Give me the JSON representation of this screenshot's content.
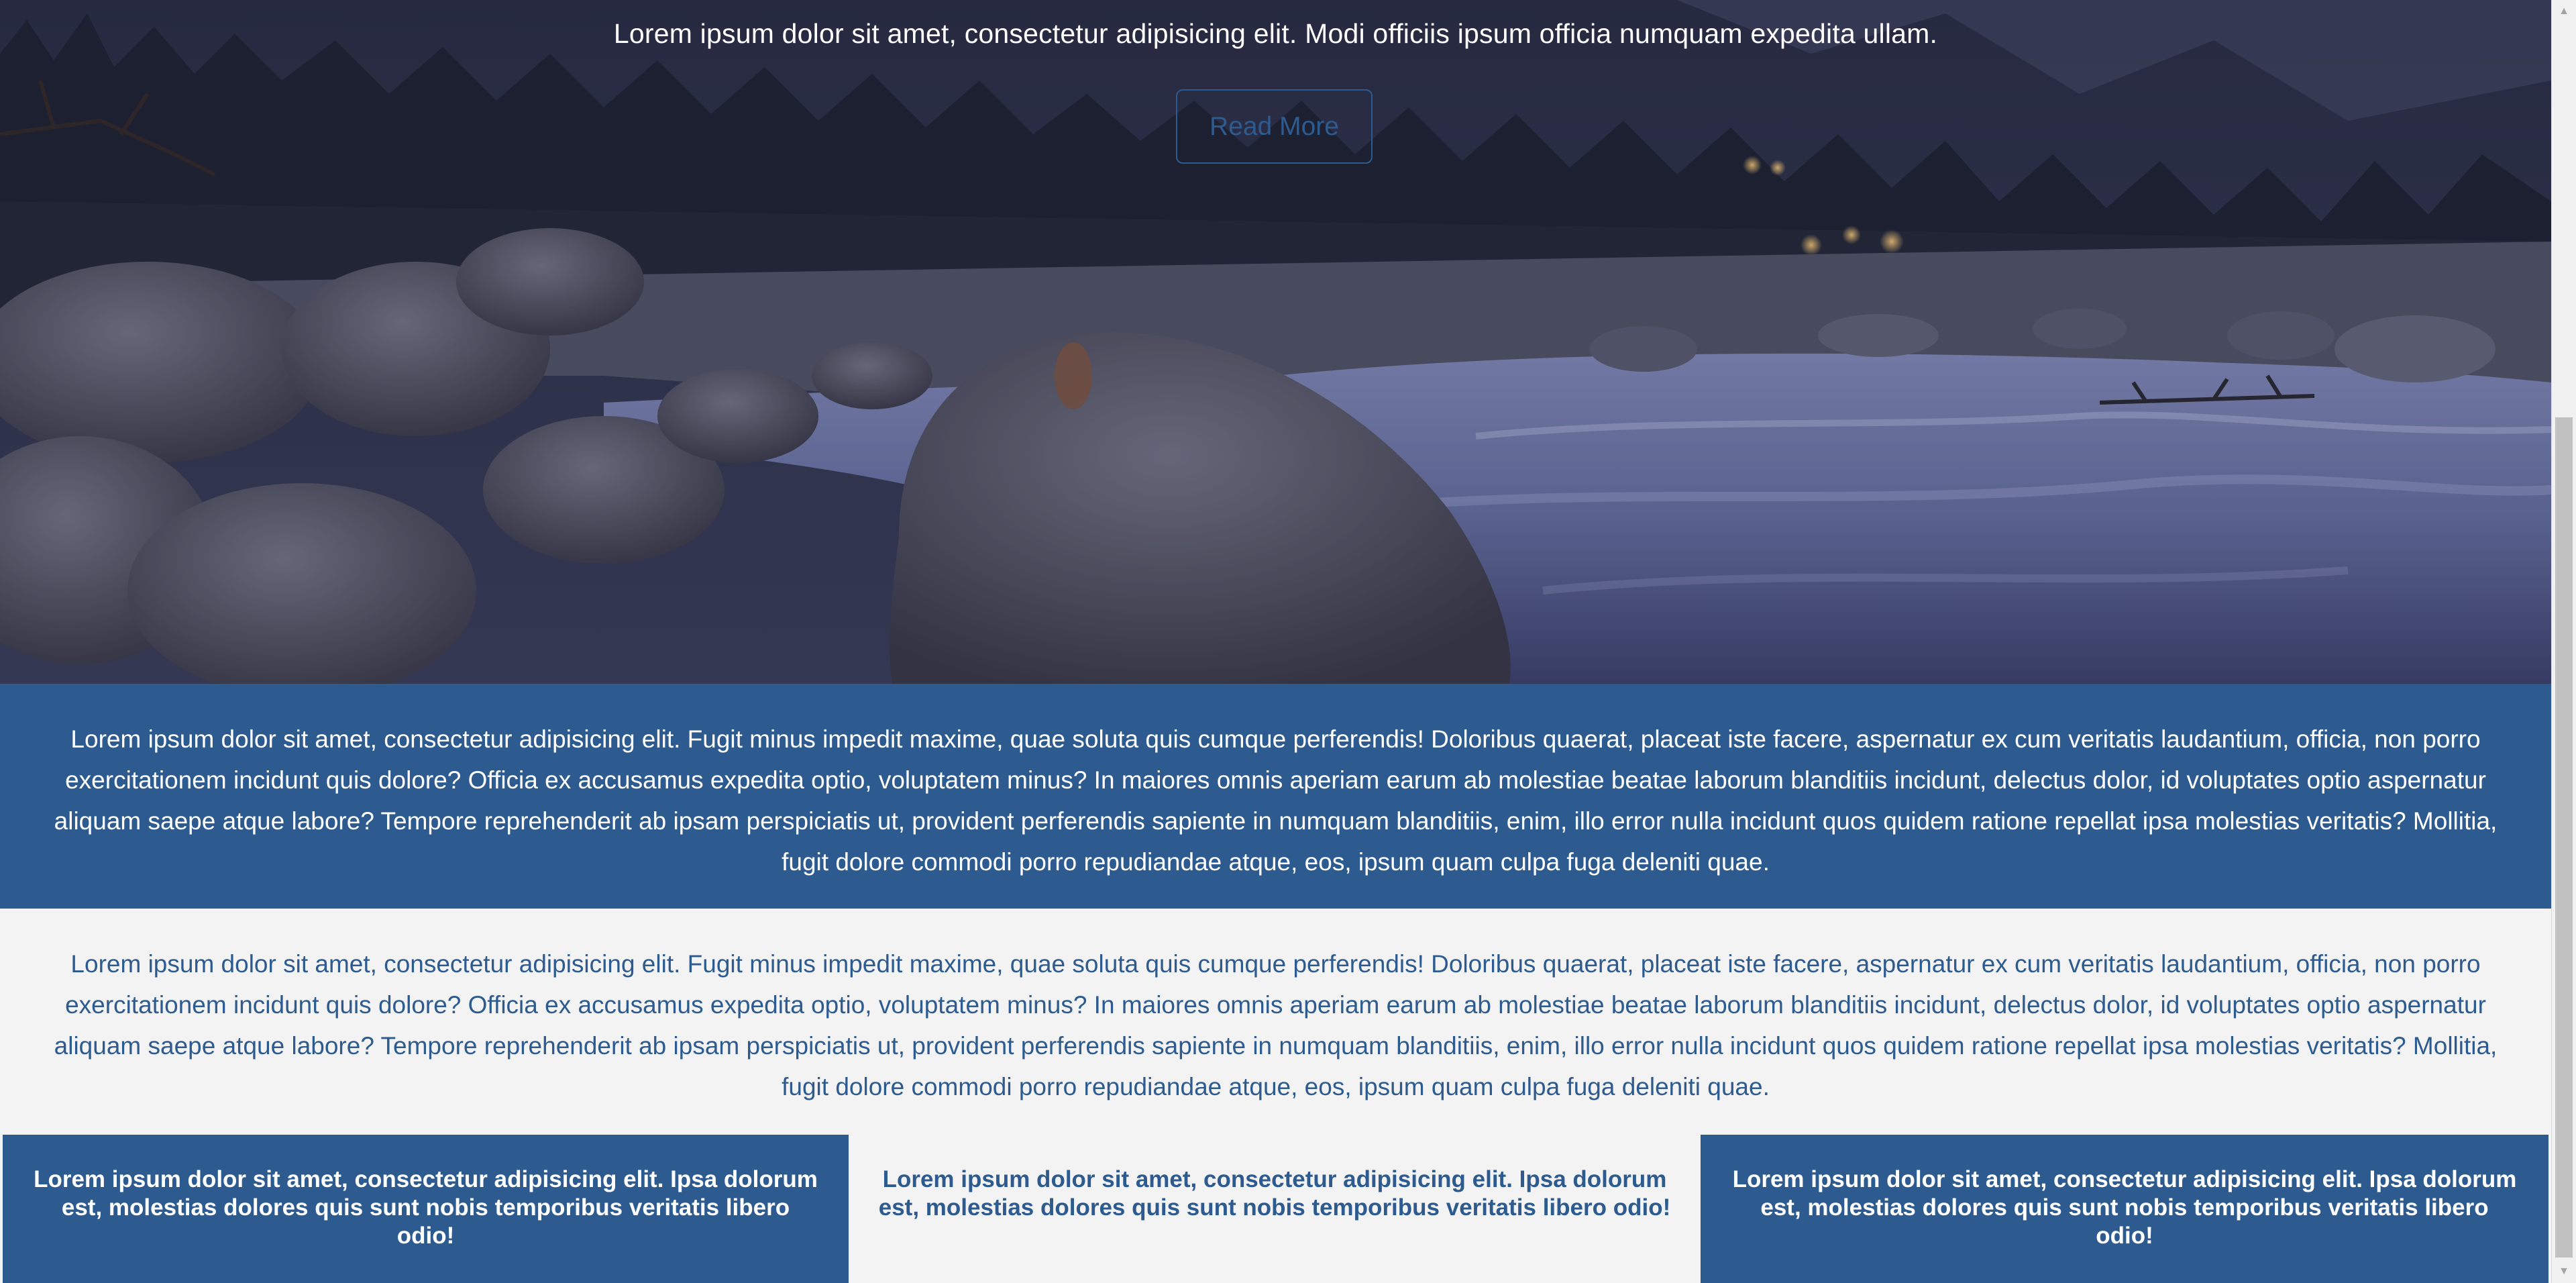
{
  "hero": {
    "tagline": "Lorem ipsum dolor sit amet, consectetur adipisicing elit. Modi officiis ipsum officia numquam expedita ullam.",
    "button_label": "Read More",
    "image_description_icon": "river-landscape-photo"
  },
  "band_blue": {
    "text": "Lorem ipsum dolor sit amet, consectetur adipisicing elit. Fugit minus impedit maxime, quae soluta quis cumque perferendis! Doloribus quaerat, placeat iste facere, aspernatur ex cum veritatis laudantium, officia, non porro exercitationem incidunt quis dolore? Officia ex accusamus expedita optio, voluptatem minus? In maiores omnis aperiam earum ab molestiae beatae laborum blanditiis incidunt, delectus dolor, id voluptates optio aspernatur aliquam saepe atque labore? Tempore reprehenderit ab ipsam perspiciatis ut, provident perferendis sapiente in numquam blanditiis, enim, illo error nulla incidunt quos quidem ratione repellat ipsa molestias veritatis? Mollitia, fugit dolore commodi porro repudiandae atque, eos, ipsum quam culpa fuga deleniti quae."
  },
  "band_light": {
    "text": "Lorem ipsum dolor sit amet, consectetur adipisicing elit. Fugit minus impedit maxime, quae soluta quis cumque perferendis! Doloribus quaerat, placeat iste facere, aspernatur ex cum veritatis laudantium, officia, non porro exercitationem incidunt quis dolore? Officia ex accusamus expedita optio, voluptatem minus? In maiores omnis aperiam earum ab molestiae beatae laborum blanditiis incidunt, delectus dolor, id voluptates optio aspernatur aliquam saepe atque labore? Tempore reprehenderit ab ipsam perspiciatis ut, provident perferendis sapiente in numquam blanditiis, enim, illo error nulla incidunt quos quidem ratione repellat ipsa molestias veritatis? Mollitia, fugit dolore commodi porro repudiandae atque, eos, ipsum quam culpa fuga deleniti quae."
  },
  "cards": [
    {
      "text": "Lorem ipsum dolor sit amet, consectetur adipisicing elit. Ipsa dolorum est, molestias dolores quis sunt nobis temporibus veritatis libero odio!"
    },
    {
      "text": "Lorem ipsum dolor sit amet, consectetur adipisicing elit. Ipsa dolorum est, molestias dolores quis sunt nobis temporibus veritatis libero odio!"
    },
    {
      "text": "Lorem ipsum dolor sit amet, consectetur adipisicing elit. Ipsa dolorum est, molestias dolores quis sunt nobis temporibus veritatis libero odio!"
    }
  ],
  "colors": {
    "brand_blue": "#2d5b8f",
    "light_bg": "#f3f3f3",
    "white": "#ffffff"
  },
  "scrollbar": {
    "up_icon": "scroll-up-arrow-icon",
    "down_icon": "scroll-down-arrow-icon"
  }
}
